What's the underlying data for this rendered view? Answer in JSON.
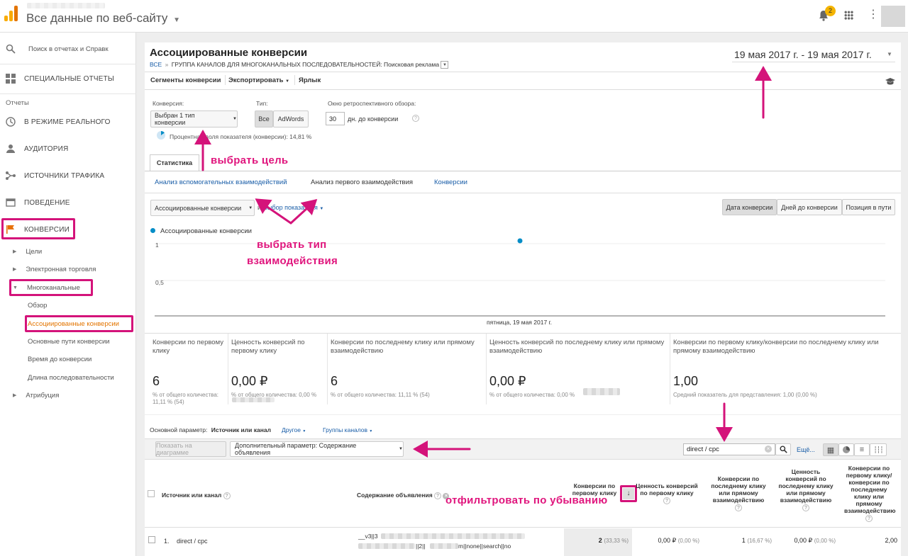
{
  "header": {
    "title": "Все данные по веб-сайту",
    "notif_count": "2"
  },
  "sidebar": {
    "search_label": "Поиск в отчетах и Справк",
    "custom_reports": "СПЕЦИАЛЬНЫЕ ОТЧЕТЫ",
    "reports_section": "Отчеты",
    "items": [
      "В РЕЖИМЕ РЕАЛЬНОГО",
      "АУДИТОРИЯ",
      "ИСТОЧНИКИ ТРАФИКА",
      "ПОВЕДЕНИЕ",
      "КОНВЕРСИИ"
    ],
    "sub": [
      "Цели",
      "Электронная торговля",
      "Многоканальные",
      "Обзор",
      "Ассоциированные конверсии",
      "Основные пути конверсии",
      "Время до конверсии",
      "Длина последовательности",
      "Атрибуция"
    ]
  },
  "report": {
    "title": "Ассоциированные конверсии",
    "breadcrumb_all": "ВСЕ",
    "breadcrumb_sep": "»",
    "breadcrumb_rest": "ГРУППА КАНАЛОВ ДЛЯ МНОГОКАНАЛЬНЫХ ПОСЛЕДОВАТЕЛЬНОСТЕЙ: Поисковая реклама",
    "date_range": "19 мая 2017 г. - 19 мая 2017 г.",
    "toolbar": {
      "segments": "Сегменты конверсии",
      "export": "Экспортировать",
      "shortcut": "Ярлык"
    }
  },
  "filters": {
    "conv_label": "Конверсия:",
    "conv_value": "Выбран 1 тип конверсии",
    "type_label": "Тип:",
    "type_all": "Все",
    "type_adwords": "AdWords",
    "lookback_label": "Окно ретроспективного обзора:",
    "lookback_value": "30",
    "lookback_suffix": "дн. до конверсии",
    "percent_text": "Процентная доля показателя (конверсии): 14,81 %"
  },
  "tabs": {
    "stats": "Статистика",
    "sub": [
      "Анализ вспомогательных взаимодействий",
      "Анализ первого взаимодействия",
      "Конверсии"
    ]
  },
  "chart_controls": {
    "metric_select": "Ассоциированные конверсии",
    "and": "и",
    "pick_metric": "Выбор показателя",
    "views": [
      "Дата конверсии",
      "Дней до конверсии",
      "Позиция в пути"
    ]
  },
  "chart_data": {
    "type": "line",
    "series": [
      {
        "name": "Ассоциированные конверсии",
        "values": [
          1
        ]
      }
    ],
    "x": [
      "пятница, 19 мая 2017 г."
    ],
    "yticks": [
      "1",
      "0,5"
    ],
    "color": "#058dc7"
  },
  "metrics": [
    {
      "label": "Конверсии по первому клику",
      "value": "6",
      "sub": "% от общего количества: 11,11 % (54)"
    },
    {
      "label": "Ценность конверсий по первому клику",
      "value": "0,00 ₽",
      "sub": "% от общего количества: 0,00 %"
    },
    {
      "label": "Конверсии по последнему клику или прямому взаимодействию",
      "value": "6",
      "sub": "% от общего количества: 11,11 % (54)"
    },
    {
      "label": "Ценность конверсий по последнему клику или прямому взаимодействию",
      "value": "0,00 ₽",
      "sub": "% от общего количества: 0,00 %"
    },
    {
      "label": "Конверсии по первому клику/конверсии по последнему клику или прямому взаимодействию",
      "value": "1,00",
      "sub": "Средний показатель для представления: 1,00 (0,00 %)"
    }
  ],
  "table": {
    "primary_label": "Основной параметр:",
    "primary_value": "Источник или канал",
    "other": "Другое",
    "channel_groups": "Группы каналов",
    "plot_rows": "Показать на диаграмме",
    "secondary": "Дополнительный параметр: Содержание объявления",
    "search_value": "direct / cpc",
    "more": "Ещё...",
    "headers": [
      "Источник или канал",
      "Содержание объявления",
      "Конверсии по первому клику",
      "Ценность конверсий по первому клику",
      "Конверсии по последнему клику или прямому взаимодействию",
      "Ценность конверсий по последнему клику или прямому взаимодействию",
      "Конверсии по первому клику/ конверсии по последнему клику или прямому взаимодействию"
    ],
    "row": {
      "num": "1.",
      "source": "direct / cpc",
      "content_a": "__v3||3",
      "content_b": "||2||",
      "content_c": "m||none||search||no",
      "v1": "2",
      "v1p": "(33,33 %)",
      "v2": "0,00 ₽",
      "v2p": "(0,00 %)",
      "v3": "1",
      "v3p": "(16,67 %)",
      "v4": "0,00 ₽",
      "v4p": "(0,00 %)",
      "v5": "2,00"
    }
  },
  "annotations": {
    "goal": "выбрать цель",
    "type1": "выбрать тип",
    "type2": "взаимодействия",
    "sort": "отфильтровать по убыванию"
  }
}
